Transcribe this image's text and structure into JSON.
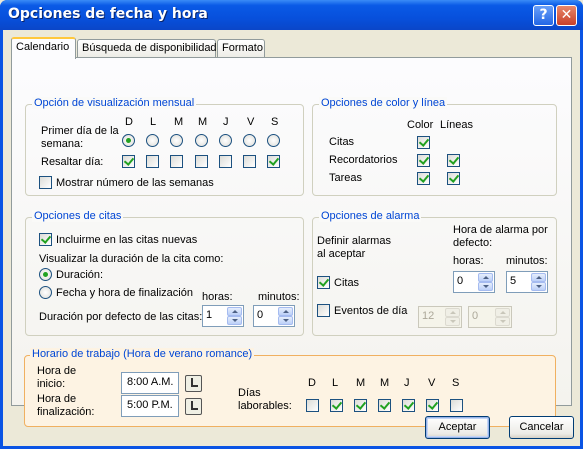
{
  "window": {
    "title": "Opciones de fecha y hora",
    "help_glyph": "?",
    "close_glyph": "✕"
  },
  "tabs": [
    {
      "label": "Calendario",
      "active": true
    },
    {
      "label": "Búsqueda de disponibilidad",
      "active": false
    },
    {
      "label": "Formato",
      "active": false
    }
  ],
  "monthly": {
    "title": "Opción de visualización mensual",
    "first_day_label_1": "Primer día de la",
    "first_day_label_2": "semana:",
    "highlight_label": "Resaltar día:",
    "days": [
      "D",
      "L",
      "M",
      "M",
      "J",
      "V",
      "S"
    ],
    "first_day_selected_index": 0,
    "highlight_checked": [
      true,
      false,
      false,
      false,
      false,
      false,
      true
    ],
    "show_week_numbers_label": "Mostrar número de las semanas",
    "show_week_numbers": false
  },
  "colors": {
    "title": "Opciones de color y línea",
    "col_color": "Color",
    "col_lines": "Líneas",
    "rows": [
      {
        "label": "Citas",
        "color": true,
        "lines": null
      },
      {
        "label": "Recordatorios",
        "color": true,
        "lines": true
      },
      {
        "label": "Tareas",
        "color": true,
        "lines": true
      }
    ]
  },
  "appointments": {
    "title": "Opciones de citas",
    "include_me_label": "Incluirme en las citas nuevas",
    "include_me": true,
    "visualize_label": "Visualizar la duración de la cita como:",
    "radio_duration_label": "Duración:",
    "radio_end_label": "Fecha y hora de finalización",
    "duration_selected": true,
    "hours_label": "horas:",
    "minutes_label": "minutos:",
    "default_duration_label": "Duración por defecto de las citas:",
    "hours_value": "1",
    "minutes_value": "0"
  },
  "alarms": {
    "title": "Opciones de alarma",
    "define_label_1": "Definir alarmas",
    "define_label_2": "al aceptar",
    "alarm_hour_label_1": "Hora de alarma por",
    "alarm_hour_label_2": "defecto:",
    "hours_label": "horas:",
    "minutes_label": "minutos:",
    "citas_label": "Citas",
    "citas_checked": true,
    "citas_hours": "0",
    "citas_minutes": "5",
    "events_label": "Eventos de día",
    "events_checked": false,
    "events_hours": "12",
    "events_minutes": "0"
  },
  "work": {
    "title": "Horario de trabajo (Hora de verano romance)",
    "start_label_1": "Hora de",
    "start_label_2": "inicio:",
    "start_value": "8:00 A.M.",
    "end_label_1": "Hora de",
    "end_label_2": "finalización:",
    "end_value": "5:00 P.M.",
    "workdays_label_1": "Días",
    "workdays_label_2": "laborables:",
    "days": [
      "D",
      "L",
      "M",
      "M",
      "J",
      "V",
      "S"
    ],
    "days_checked": [
      false,
      true,
      true,
      true,
      true,
      true,
      false
    ]
  },
  "footer": {
    "accept_label": "Aceptar",
    "cancel_label": "Cancelar"
  }
}
